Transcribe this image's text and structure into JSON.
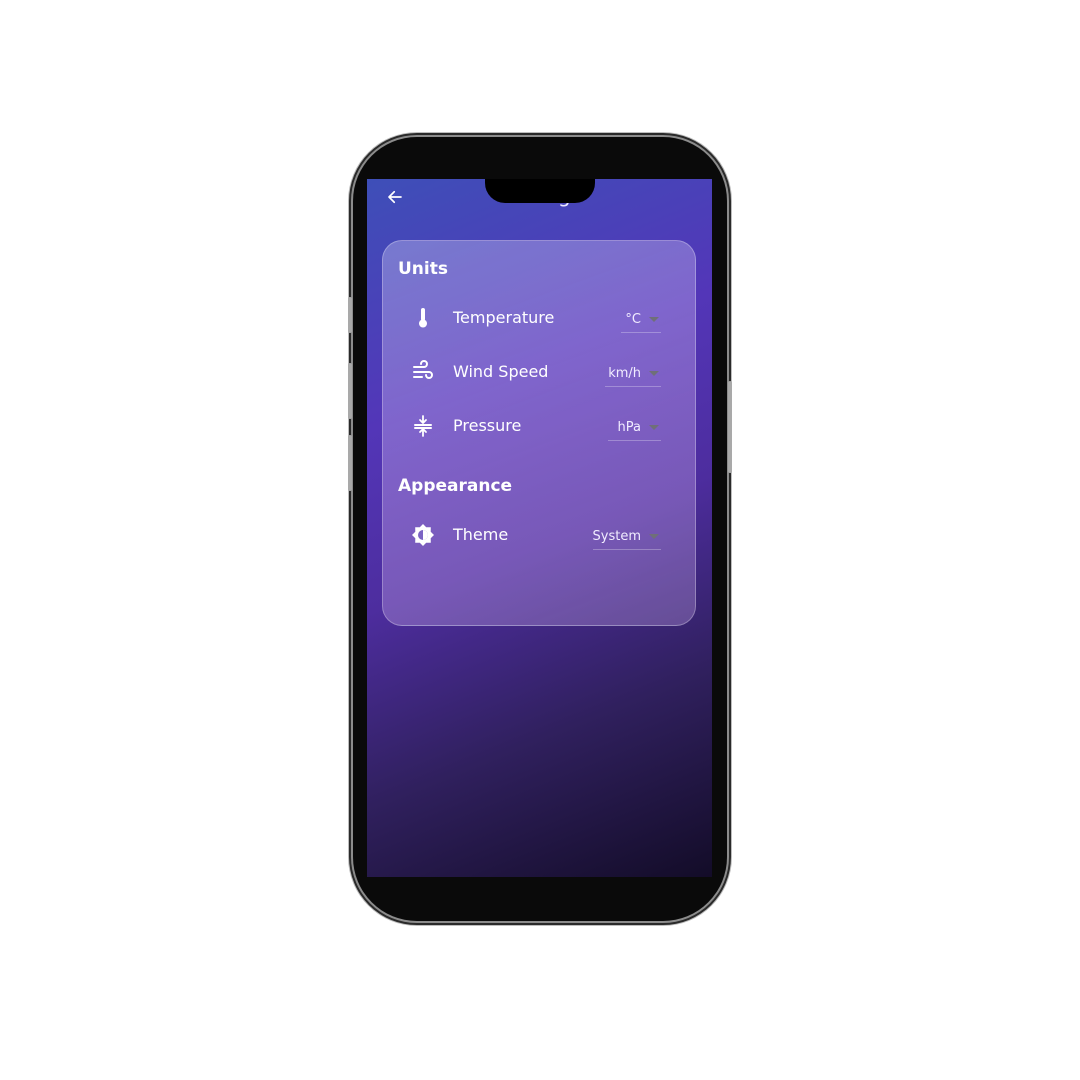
{
  "header": {
    "title": "Settings",
    "back_icon": "arrow-left-icon"
  },
  "units": {
    "title": "Units",
    "rows": [
      {
        "label": "Temperature",
        "value": "°C",
        "icon": "thermometer-icon"
      },
      {
        "label": "Wind Speed",
        "value": "km/h",
        "icon": "wind-icon"
      },
      {
        "label": "Pressure",
        "value": "hPa",
        "icon": "compress-icon"
      }
    ]
  },
  "appearance": {
    "title": "Appearance",
    "rows": [
      {
        "label": "Theme",
        "value": "System",
        "icon": "brightness-icon"
      }
    ]
  },
  "colors": {
    "accent_top": "#3e4fb8",
    "accent_mid": "#5336b8",
    "accent_bottom": "#130c28"
  }
}
